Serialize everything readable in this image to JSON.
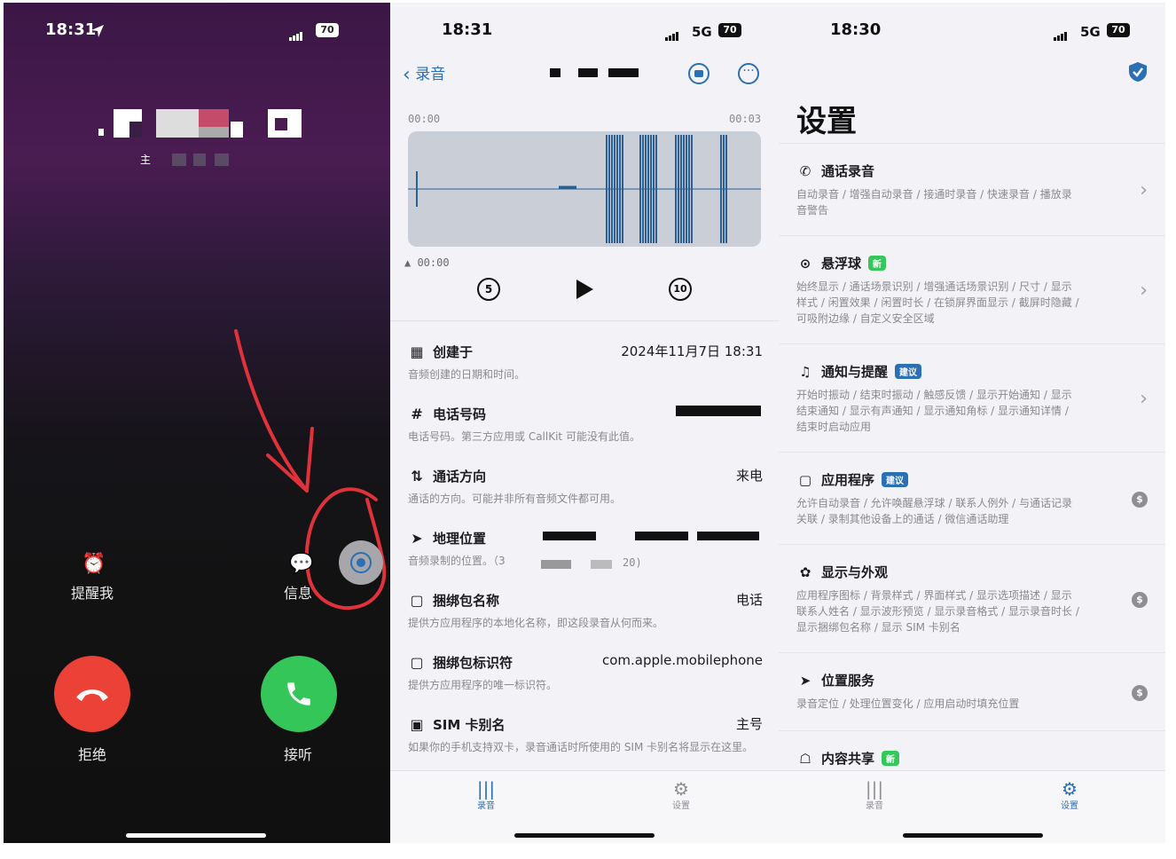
{
  "phone1": {
    "time": "18:31",
    "battery": "70",
    "caller_sub": "主",
    "actions": [
      {
        "label": "提醒我",
        "icon": "alarm-icon"
      },
      {
        "label": "信息",
        "icon": "message-icon"
      }
    ],
    "decline_label": "拒绝",
    "accept_label": "接听"
  },
  "phone2": {
    "time": "18:31",
    "network": "5G",
    "battery": "70",
    "back_label": "录音",
    "time_start": "00:00",
    "time_end": "00:03",
    "playhead_time": "00:00",
    "skip_back": "5",
    "skip_forward": "10",
    "items": [
      {
        "icon": "calendar-icon",
        "title": "创建于",
        "value": "2024年11月7日 18:31",
        "desc": "音频创建的日期和时间。"
      },
      {
        "icon": "hash-icon",
        "title": "电话号码",
        "value": "",
        "desc": "电话号码。第三方应用或 CallKit 可能没有此值。"
      },
      {
        "icon": "direction-icon",
        "title": "通话方向",
        "value": "来电",
        "desc": "通话的方向。可能并非所有音频文件都可用。"
      },
      {
        "icon": "location-icon",
        "title": "地理位置",
        "value": "",
        "desc": "音频录制的位置。（3"
      },
      {
        "icon": "bundle-name-icon",
        "title": "捆绑包名称",
        "value": "电话",
        "desc": "提供方应用程序的本地化名称，即这段录音从何而来。"
      },
      {
        "icon": "bundle-id-icon",
        "title": "捆绑包标识符",
        "value": "com.apple.mobilephone",
        "desc": "提供方应用程序的唯一标识符。"
      },
      {
        "icon": "sim-icon",
        "title": "SIM 卡别名",
        "value": "主号",
        "desc": "如果你的手机支持双卡，录音通话时所使用的 SIM 卡别名将显示在这里。"
      }
    ],
    "location_suffix": "20)",
    "tabs": [
      {
        "label": "录音",
        "icon": "waveform-icon",
        "active": true
      },
      {
        "label": "设置",
        "icon": "settings-icon",
        "active": false
      }
    ]
  },
  "phone3": {
    "time": "18:30",
    "network": "5G",
    "battery": "70",
    "title": "设置",
    "sections": [
      {
        "icon": "phone-icon",
        "title": "通话录音",
        "badge": "",
        "desc": "自动录音 / 增强自动录音 / 接通时录音 / 快速录音 / 播放录音警告",
        "trail": "chevron"
      },
      {
        "icon": "floating-ball-icon",
        "title": "悬浮球",
        "badge": "新",
        "desc": "始终显示 / 通话场景识别 / 增强通话场景识别 / 尺寸 / 显示样式 / 闲置效果 / 闲置时长 / 在锁屏界面显示 / 截屏时隐藏 / 可吸附边缘 / 自定义安全区域",
        "trail": "chevron"
      },
      {
        "icon": "bell-icon",
        "title": "通知与提醒",
        "badge": "建议",
        "desc": "开始时振动 / 结束时振动 / 触感反馈 / 显示开始通知 / 显示结束通知 / 显示有声通知 / 显示通知角标 / 显示通知详情 / 结束时启动应用",
        "trail": "chevron"
      },
      {
        "icon": "app-icon",
        "title": "应用程序",
        "badge": "建议",
        "desc": "允许自动录音 / 允许唤醒悬浮球 / 联系人例外 / 与通话记录关联 / 录制其他设备上的通话 / 微信通话助理",
        "trail": "coin"
      },
      {
        "icon": "palette-icon",
        "title": "显示与外观",
        "badge": "",
        "desc": "应用程序图标 / 背景样式 / 界面样式 / 显示选项描述 / 显示联系人姓名 / 显示波形预览 / 显示录音格式 / 显示录音时长 / 显示捆绑包名称 / 显示 SIM 卡别名",
        "trail": "coin"
      },
      {
        "icon": "location-arrow-icon",
        "title": "位置服务",
        "badge": "",
        "desc": "录音定位 / 处理位置变化 / 应用启动时填充位置",
        "trail": "coin"
      },
      {
        "icon": "share-icon",
        "title": "内容共享",
        "badge": "新",
        "desc": "",
        "trail": ""
      }
    ],
    "coin_symbol": "$",
    "tabs": [
      {
        "label": "录音",
        "icon": "waveform-icon",
        "active": false
      },
      {
        "label": "设置",
        "icon": "settings-icon",
        "active": true
      }
    ]
  },
  "colors": {
    "accent": "#2b6fb4",
    "badge_green": "#34c759",
    "badge_blue": "#2b6fb4",
    "decline": "#eb4137",
    "accept": "#35c65a",
    "annotation": "#e0323a"
  }
}
